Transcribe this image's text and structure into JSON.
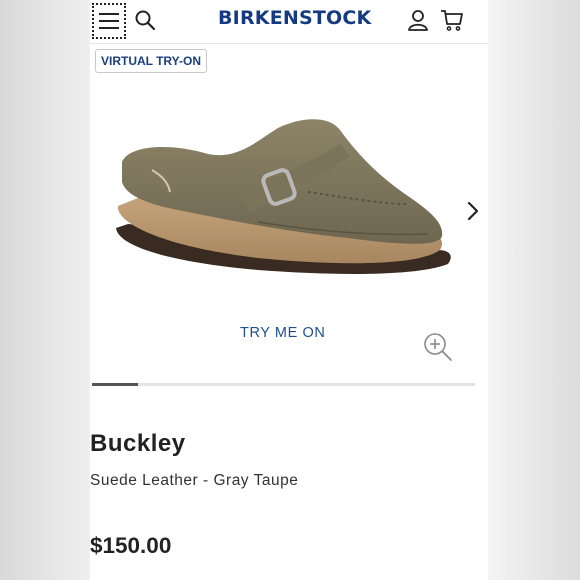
{
  "header": {
    "brand": "BIRKENSTOCK",
    "brand_color": "#143a82",
    "icons": [
      "menu-icon",
      "search-icon",
      "account-icon",
      "cart-icon"
    ]
  },
  "gallery": {
    "badge_label": "VIRTUAL TRY-ON",
    "try_link_label": "TRY ME ON",
    "next_icon": "chevron-right-icon",
    "zoom_icon": "zoom-in-icon",
    "progress": 0.12
  },
  "product": {
    "name": "Buckley",
    "variant": "Suede Leather - Gray Taupe",
    "price": "$150.00"
  }
}
